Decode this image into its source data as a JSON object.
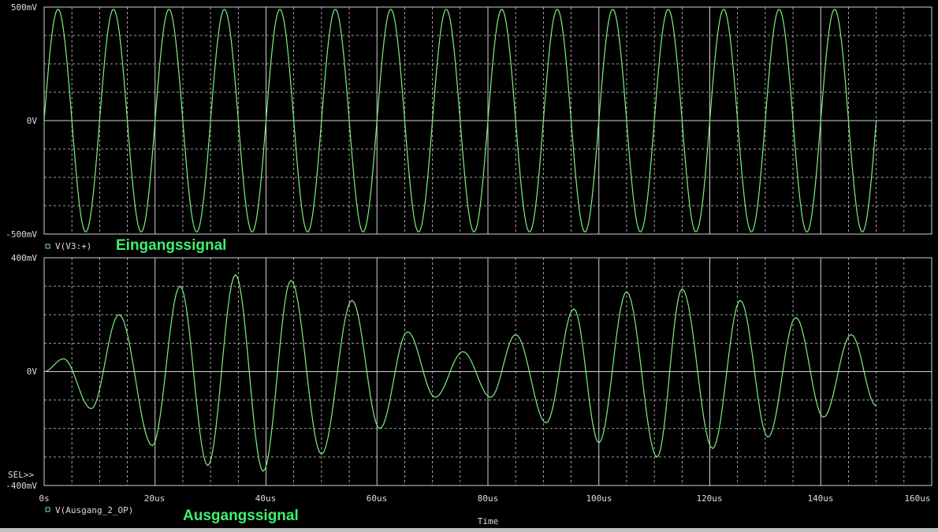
{
  "colors": {
    "background": "#000000",
    "grid": "#cfcfcf",
    "trace": "#7cf07c",
    "legend_text": "#dcdcdc",
    "annotation": "#40f070",
    "axis_text": "#dcdcdc"
  },
  "sel_label": "SEL>>",
  "x_axis": {
    "title": "Time",
    "range_us": [
      0,
      160
    ],
    "ticks": [
      "0s",
      "20us",
      "40us",
      "60us",
      "80us",
      "100us",
      "120us",
      "140us",
      "160us"
    ]
  },
  "chart_data": [
    {
      "type": "line",
      "panel": "top",
      "ylim_mV": [
        -500,
        500
      ],
      "y_ticks": [
        "500mV",
        "0V",
        "-500mV"
      ],
      "legend_marker": "square-icon",
      "series": [
        {
          "name": "V(V3:+)",
          "color": "#7cf07c",
          "x_us": [
            0,
            150
          ],
          "function": "sine",
          "amplitude_mV": 490,
          "frequency_kHz": 100
        }
      ],
      "annotation": "Eingangssignal"
    },
    {
      "type": "line",
      "panel": "bottom",
      "ylim_mV": [
        -400,
        400
      ],
      "y_ticks": [
        "400mV",
        "0V",
        "-400mV"
      ],
      "legend_marker": "square-icon",
      "series": [
        {
          "name": "V(Ausgang_2_OP)",
          "color": "#7cf07c",
          "x_us": [
            0,
            150
          ],
          "function": "sine",
          "frequency_kHz": 100,
          "peaks": [
            {
              "t_us": 3.5,
              "v_mV": 45
            },
            {
              "t_us": 8.5,
              "v_mV": -130
            },
            {
              "t_us": 13.5,
              "v_mV": 200
            },
            {
              "t_us": 19.5,
              "v_mV": -260
            },
            {
              "t_us": 24.5,
              "v_mV": 300
            },
            {
              "t_us": 29.5,
              "v_mV": -330
            },
            {
              "t_us": 34.5,
              "v_mV": 340
            },
            {
              "t_us": 39.5,
              "v_mV": -350
            },
            {
              "t_us": 44.5,
              "v_mV": 320
            },
            {
              "t_us": 50,
              "v_mV": -290
            },
            {
              "t_us": 55.5,
              "v_mV": 250
            },
            {
              "t_us": 60.5,
              "v_mV": -200
            },
            {
              "t_us": 65.5,
              "v_mV": 140
            },
            {
              "t_us": 70.5,
              "v_mV": -90
            },
            {
              "t_us": 75.5,
              "v_mV": 70
            },
            {
              "t_us": 80.5,
              "v_mV": -90
            },
            {
              "t_us": 85,
              "v_mV": 130
            },
            {
              "t_us": 90.5,
              "v_mV": -180
            },
            {
              "t_us": 95.5,
              "v_mV": 220
            },
            {
              "t_us": 100,
              "v_mV": -250
            },
            {
              "t_us": 105,
              "v_mV": 280
            },
            {
              "t_us": 110.5,
              "v_mV": -300
            },
            {
              "t_us": 115,
              "v_mV": 290
            },
            {
              "t_us": 120.5,
              "v_mV": -270
            },
            {
              "t_us": 125.5,
              "v_mV": 250
            },
            {
              "t_us": 130.5,
              "v_mV": -230
            },
            {
              "t_us": 135.5,
              "v_mV": 190
            },
            {
              "t_us": 140.5,
              "v_mV": -160
            },
            {
              "t_us": 145.5,
              "v_mV": 130
            },
            {
              "t_us": 150,
              "v_mV": -120
            }
          ]
        }
      ],
      "annotation": "Ausgangssignal"
    }
  ]
}
